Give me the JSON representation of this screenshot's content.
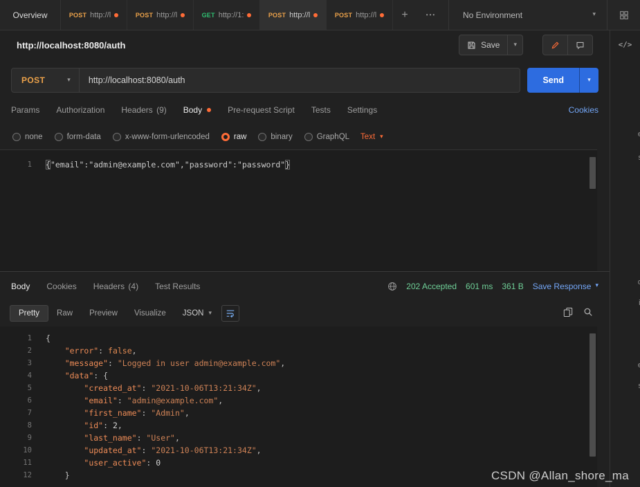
{
  "colors": {
    "accent_orange": "#ff6c37",
    "method_post": "#eca24a",
    "method_get": "#2fbf71",
    "status_green": "#6fcf97",
    "link_blue": "#74a7f8",
    "send_blue": "#2d6ce0"
  },
  "icons": {
    "plus": "+",
    "more": "•••",
    "chevron_down": "▾",
    "code_panel": "</>",
    "unsaved_dot": "●",
    "save": "floppy-svg",
    "edit": "pencil-svg",
    "comment": "bubble-svg",
    "globe": "globe-svg",
    "copy": "copy-svg",
    "search": "magnifier-svg",
    "wrap_line": "wrap-svg",
    "environment_quick_look": "grid-svg"
  },
  "tabbar": {
    "overview": "Overview",
    "tabs": [
      {
        "method": "POST",
        "label": "http://l",
        "dirty": true,
        "active": false
      },
      {
        "method": "POST",
        "label": "http://l",
        "dirty": true,
        "active": false
      },
      {
        "method": "GET",
        "label": "http://1:",
        "dirty": true,
        "active": false
      },
      {
        "method": "POST",
        "label": "http://l",
        "dirty": true,
        "active": true
      },
      {
        "method": "POST",
        "label": "http://l",
        "dirty": true,
        "active": false
      }
    ],
    "environment": "No Environment"
  },
  "request": {
    "title": "http://localhost:8080/auth",
    "save": "Save",
    "method": "POST",
    "url": "http://localhost:8080/auth",
    "send": "Send",
    "tabs": [
      {
        "label": "Params"
      },
      {
        "label": "Authorization"
      },
      {
        "label": "Headers",
        "count": "(9)"
      },
      {
        "label": "Body",
        "active": true,
        "dot": true
      },
      {
        "label": "Pre-request Script"
      },
      {
        "label": "Tests"
      },
      {
        "label": "Settings"
      }
    ],
    "cookies": "Cookies",
    "body_types": [
      {
        "label": "none"
      },
      {
        "label": "form-data"
      },
      {
        "label": "x-www-form-urlencoded"
      },
      {
        "label": "raw",
        "selected": true
      },
      {
        "label": "binary"
      },
      {
        "label": "GraphQL"
      }
    ],
    "language": "Text",
    "body_lines": [
      [
        {
          "t": "{",
          "c": "brace"
        },
        {
          "t": "\"email\":\"admin@example.com\",\"password\":\"password\"",
          "c": "plain"
        },
        {
          "t": "}",
          "c": "brace"
        }
      ]
    ]
  },
  "response": {
    "tabs": [
      {
        "label": "Body",
        "active": true
      },
      {
        "label": "Cookies"
      },
      {
        "label": "Headers",
        "count": "(4)"
      },
      {
        "label": "Test Results"
      }
    ],
    "status": "202 Accepted",
    "time": "601 ms",
    "size": "361 B",
    "save_response": "Save Response",
    "views": [
      {
        "label": "Pretty",
        "active": true
      },
      {
        "label": "Raw"
      },
      {
        "label": "Preview"
      },
      {
        "label": "Visualize"
      }
    ],
    "format": "JSON",
    "lines": [
      [
        {
          "t": "{",
          "c": "p"
        }
      ],
      [
        {
          "t": "    ",
          "c": "p"
        },
        {
          "t": "\"error\"",
          "c": "k"
        },
        {
          "t": ": ",
          "c": "p"
        },
        {
          "t": "false",
          "c": "b"
        },
        {
          "t": ",",
          "c": "p"
        }
      ],
      [
        {
          "t": "    ",
          "c": "p"
        },
        {
          "t": "\"message\"",
          "c": "k"
        },
        {
          "t": ": ",
          "c": "p"
        },
        {
          "t": "\"Logged in user admin@example.com\"",
          "c": "s"
        },
        {
          "t": ",",
          "c": "p"
        }
      ],
      [
        {
          "t": "    ",
          "c": "p"
        },
        {
          "t": "\"data\"",
          "c": "k"
        },
        {
          "t": ": {",
          "c": "p"
        }
      ],
      [
        {
          "t": "        ",
          "c": "p"
        },
        {
          "t": "\"created_at\"",
          "c": "k"
        },
        {
          "t": ": ",
          "c": "p"
        },
        {
          "t": "\"2021-10-06T13:21:34Z\"",
          "c": "s"
        },
        {
          "t": ",",
          "c": "p"
        }
      ],
      [
        {
          "t": "        ",
          "c": "p"
        },
        {
          "t": "\"email\"",
          "c": "k"
        },
        {
          "t": ": ",
          "c": "p"
        },
        {
          "t": "\"admin@example.com\"",
          "c": "s"
        },
        {
          "t": ",",
          "c": "p"
        }
      ],
      [
        {
          "t": "        ",
          "c": "p"
        },
        {
          "t": "\"first_name\"",
          "c": "k"
        },
        {
          "t": ": ",
          "c": "p"
        },
        {
          "t": "\"Admin\"",
          "c": "s"
        },
        {
          "t": ",",
          "c": "p"
        }
      ],
      [
        {
          "t": "        ",
          "c": "p"
        },
        {
          "t": "\"id\"",
          "c": "k"
        },
        {
          "t": ": ",
          "c": "p"
        },
        {
          "t": "2",
          "c": "n"
        },
        {
          "t": ",",
          "c": "p"
        }
      ],
      [
        {
          "t": "        ",
          "c": "p"
        },
        {
          "t": "\"last_name\"",
          "c": "k"
        },
        {
          "t": ": ",
          "c": "p"
        },
        {
          "t": "\"User\"",
          "c": "s"
        },
        {
          "t": ",",
          "c": "p"
        }
      ],
      [
        {
          "t": "        ",
          "c": "p"
        },
        {
          "t": "\"updated_at\"",
          "c": "k"
        },
        {
          "t": ": ",
          "c": "p"
        },
        {
          "t": "\"2021-10-06T13:21:34Z\"",
          "c": "s"
        },
        {
          "t": ",",
          "c": "p"
        }
      ],
      [
        {
          "t": "        ",
          "c": "p"
        },
        {
          "t": "\"user_active\"",
          "c": "k"
        },
        {
          "t": ": ",
          "c": "p"
        },
        {
          "t": "0",
          "c": "n"
        }
      ],
      [
        {
          "t": "    }",
          "c": "p"
        }
      ]
    ]
  },
  "rail": {
    "fragments": [
      "e",
      "s",
      "d",
      "il",
      "e",
      "s"
    ]
  },
  "watermark": "CSDN @Allan_shore_ma"
}
